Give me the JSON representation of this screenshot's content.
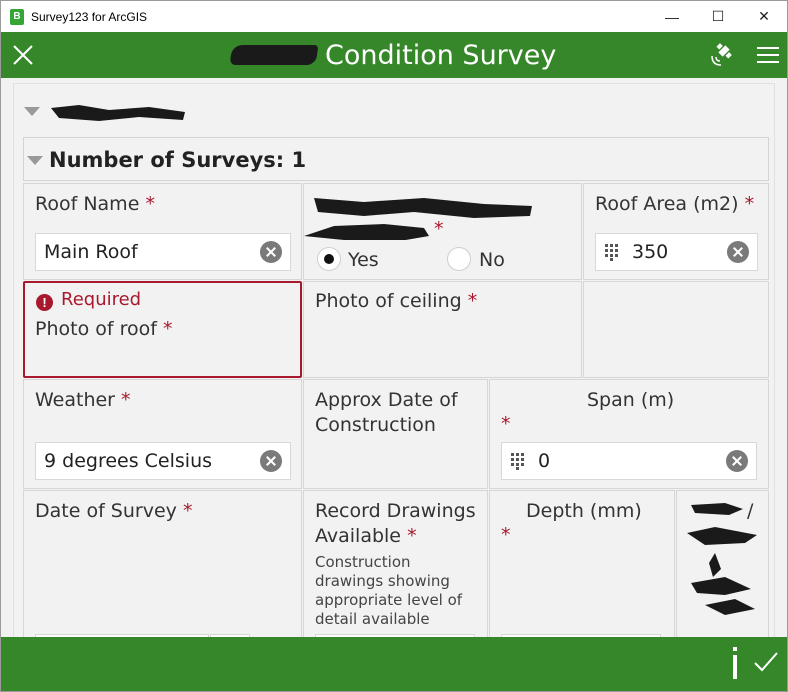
{
  "window": {
    "title": "Survey123 for ArcGIS",
    "app_icon_glyph": "B",
    "minimize": "—",
    "maximize": "☐",
    "close": "✕"
  },
  "header": {
    "title": "Condition Survey",
    "accent": "#35872a"
  },
  "group": {
    "redacted": true
  },
  "repeat": {
    "label": "Number of Surveys: 1"
  },
  "required_mark": "*",
  "fields": {
    "roof_name": {
      "label": "Roof Name",
      "value": "Main Roof"
    },
    "redacted_question": {
      "label_suffix": "*",
      "options": [
        "Yes",
        "No"
      ],
      "selected": "Yes"
    },
    "roof_area": {
      "label": "Roof Area (m2)",
      "value": "350"
    },
    "photo_roof": {
      "error": "Required",
      "label": "Photo of roof"
    },
    "photo_ceiling": {
      "label": "Photo of ceiling"
    },
    "weather": {
      "label": "Weather",
      "value": "9 degrees Celsius"
    },
    "approx_date": {
      "label_line1": "Approx Date of",
      "label_line2": "Construction"
    },
    "span": {
      "label": "Span (m)",
      "value": "0"
    },
    "date_of_survey": {
      "label": "Date of Survey"
    },
    "record_drawings": {
      "label_line1": "Record Drawings",
      "label_line2": "Available",
      "hint_lines": [
        "Construction",
        "drawings showing",
        "appropriate level of",
        "detail available"
      ]
    },
    "depth": {
      "label": "Depth (mm)"
    },
    "redacted_partial": {
      "visible_text": "/"
    }
  },
  "colors": {
    "required": "#a8192e",
    "header_bg": "#35872a"
  }
}
